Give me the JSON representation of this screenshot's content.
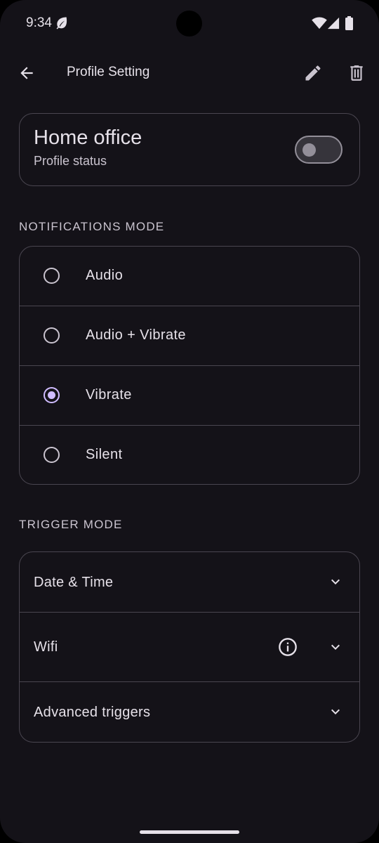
{
  "status_bar": {
    "time": "9:34",
    "icons": [
      "leaf-icon",
      "wifi-icon",
      "signal-icon",
      "battery-icon"
    ]
  },
  "app_bar": {
    "title": "Profile Setting",
    "icons": [
      "back-arrow-icon",
      "pencil-icon",
      "trash-icon"
    ]
  },
  "profile": {
    "name": "Home office",
    "status_label": "Profile status",
    "enabled": false
  },
  "notifications": {
    "header": "NOTIFICATIONS MODE",
    "options": [
      {
        "label": "Audio",
        "selected": false
      },
      {
        "label": "Audio + Vibrate",
        "selected": false
      },
      {
        "label": "Vibrate",
        "selected": true
      },
      {
        "label": "Silent",
        "selected": false
      }
    ]
  },
  "triggers": {
    "header": "TRIGGER MODE",
    "items": [
      {
        "label": "Date & Time",
        "icon": "chevron-down-icon"
      },
      {
        "label": "Wifi",
        "icon": "chevron-down-icon",
        "extra_icon": "info-icon"
      },
      {
        "label": "Advanced triggers",
        "icon": "chevron-down-icon"
      }
    ]
  },
  "colors": {
    "background": "#141218",
    "accent": "#d0bcff",
    "outline": "#4a4650",
    "text": "#e6e1e9",
    "secondary_text": "#cac4cf"
  }
}
